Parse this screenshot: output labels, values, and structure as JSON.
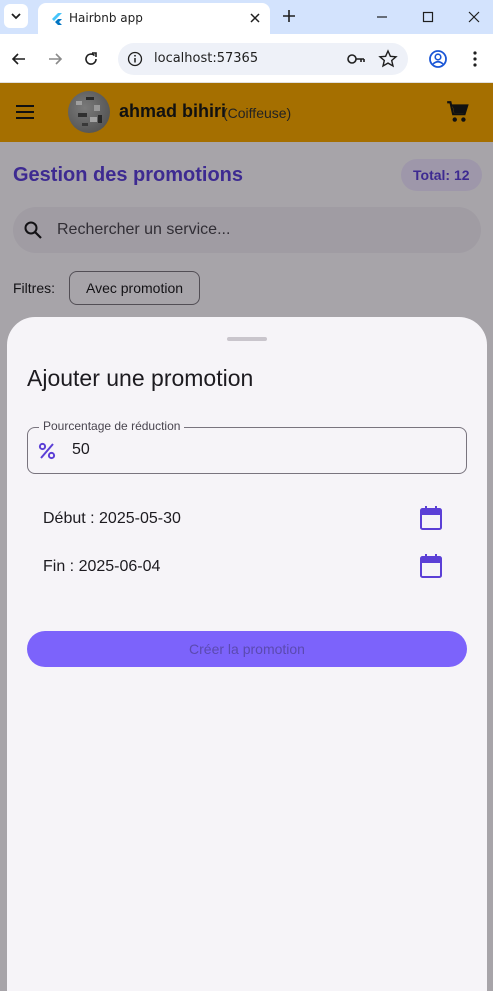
{
  "browser": {
    "tab_title": "Hairbnb app",
    "url": "localhost:57365"
  },
  "appbar": {
    "user_name": "ahmad bihiri",
    "user_role": "(Coiffeuse)"
  },
  "page": {
    "title": "Gestion des promotions",
    "total": "Total: 12",
    "search_placeholder": "Rechercher un service...",
    "filters_label": "Filtres:",
    "filter_chip": "Avec promotion"
  },
  "sheet": {
    "title": "Ajouter une promotion",
    "percent_label": "Pourcentage de réduction",
    "percent_value": "50",
    "start_date": "Début : 2025-05-30",
    "end_date": "Fin : 2025-06-04",
    "create_button": "Créer la promotion"
  },
  "colors": {
    "appbar": "#f4a400",
    "accent": "#5b3fd6",
    "button": "#7c63fb"
  }
}
